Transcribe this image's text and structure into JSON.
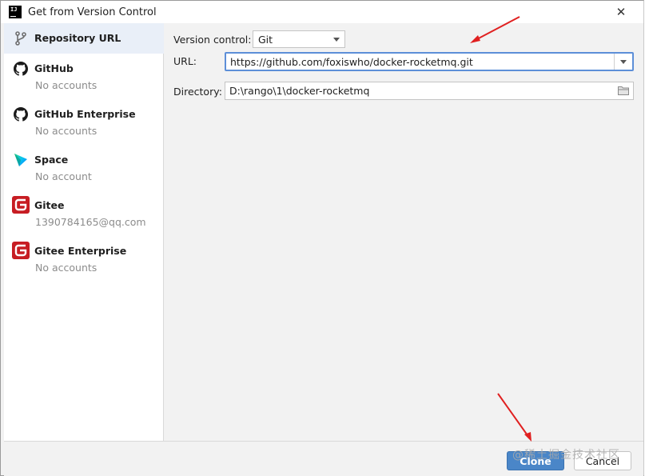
{
  "window": {
    "title": "Get from Version Control",
    "app_icon_text": "IJ",
    "close_glyph": "✕"
  },
  "sidebar": {
    "items": [
      {
        "label": "Repository URL",
        "sub": "",
        "icon": "branch-icon",
        "selected": true
      },
      {
        "label": "GitHub",
        "sub": "No accounts",
        "icon": "github-icon"
      },
      {
        "label": "GitHub Enterprise",
        "sub": "No accounts",
        "icon": "github-icon"
      },
      {
        "label": "Space",
        "sub": "No account",
        "icon": "space-icon"
      },
      {
        "label": "Gitee",
        "sub": "1390784165@qq.com",
        "icon": "gitee-icon"
      },
      {
        "label": "Gitee Enterprise",
        "sub": "No accounts",
        "icon": "gitee-icon"
      }
    ]
  },
  "form": {
    "vcs_label": "Version control:",
    "vcs_value": "Git",
    "url_label": "URL:",
    "url_value": "https://github.com/foxiswho/docker-rocketmq.git",
    "dir_label": "Directory:",
    "dir_value": "D:\\rango\\1\\docker-rocketmq"
  },
  "footer": {
    "clone_label": "Clone",
    "cancel_label": "Cancel"
  },
  "watermark": "@稀土掘金技术社区",
  "colors": {
    "accent": "#4a86c8",
    "selection": "#e9eff8",
    "focus_border": "#5d8fd8",
    "gitee_red": "#c71d23",
    "annotation_red": "#e02020"
  }
}
